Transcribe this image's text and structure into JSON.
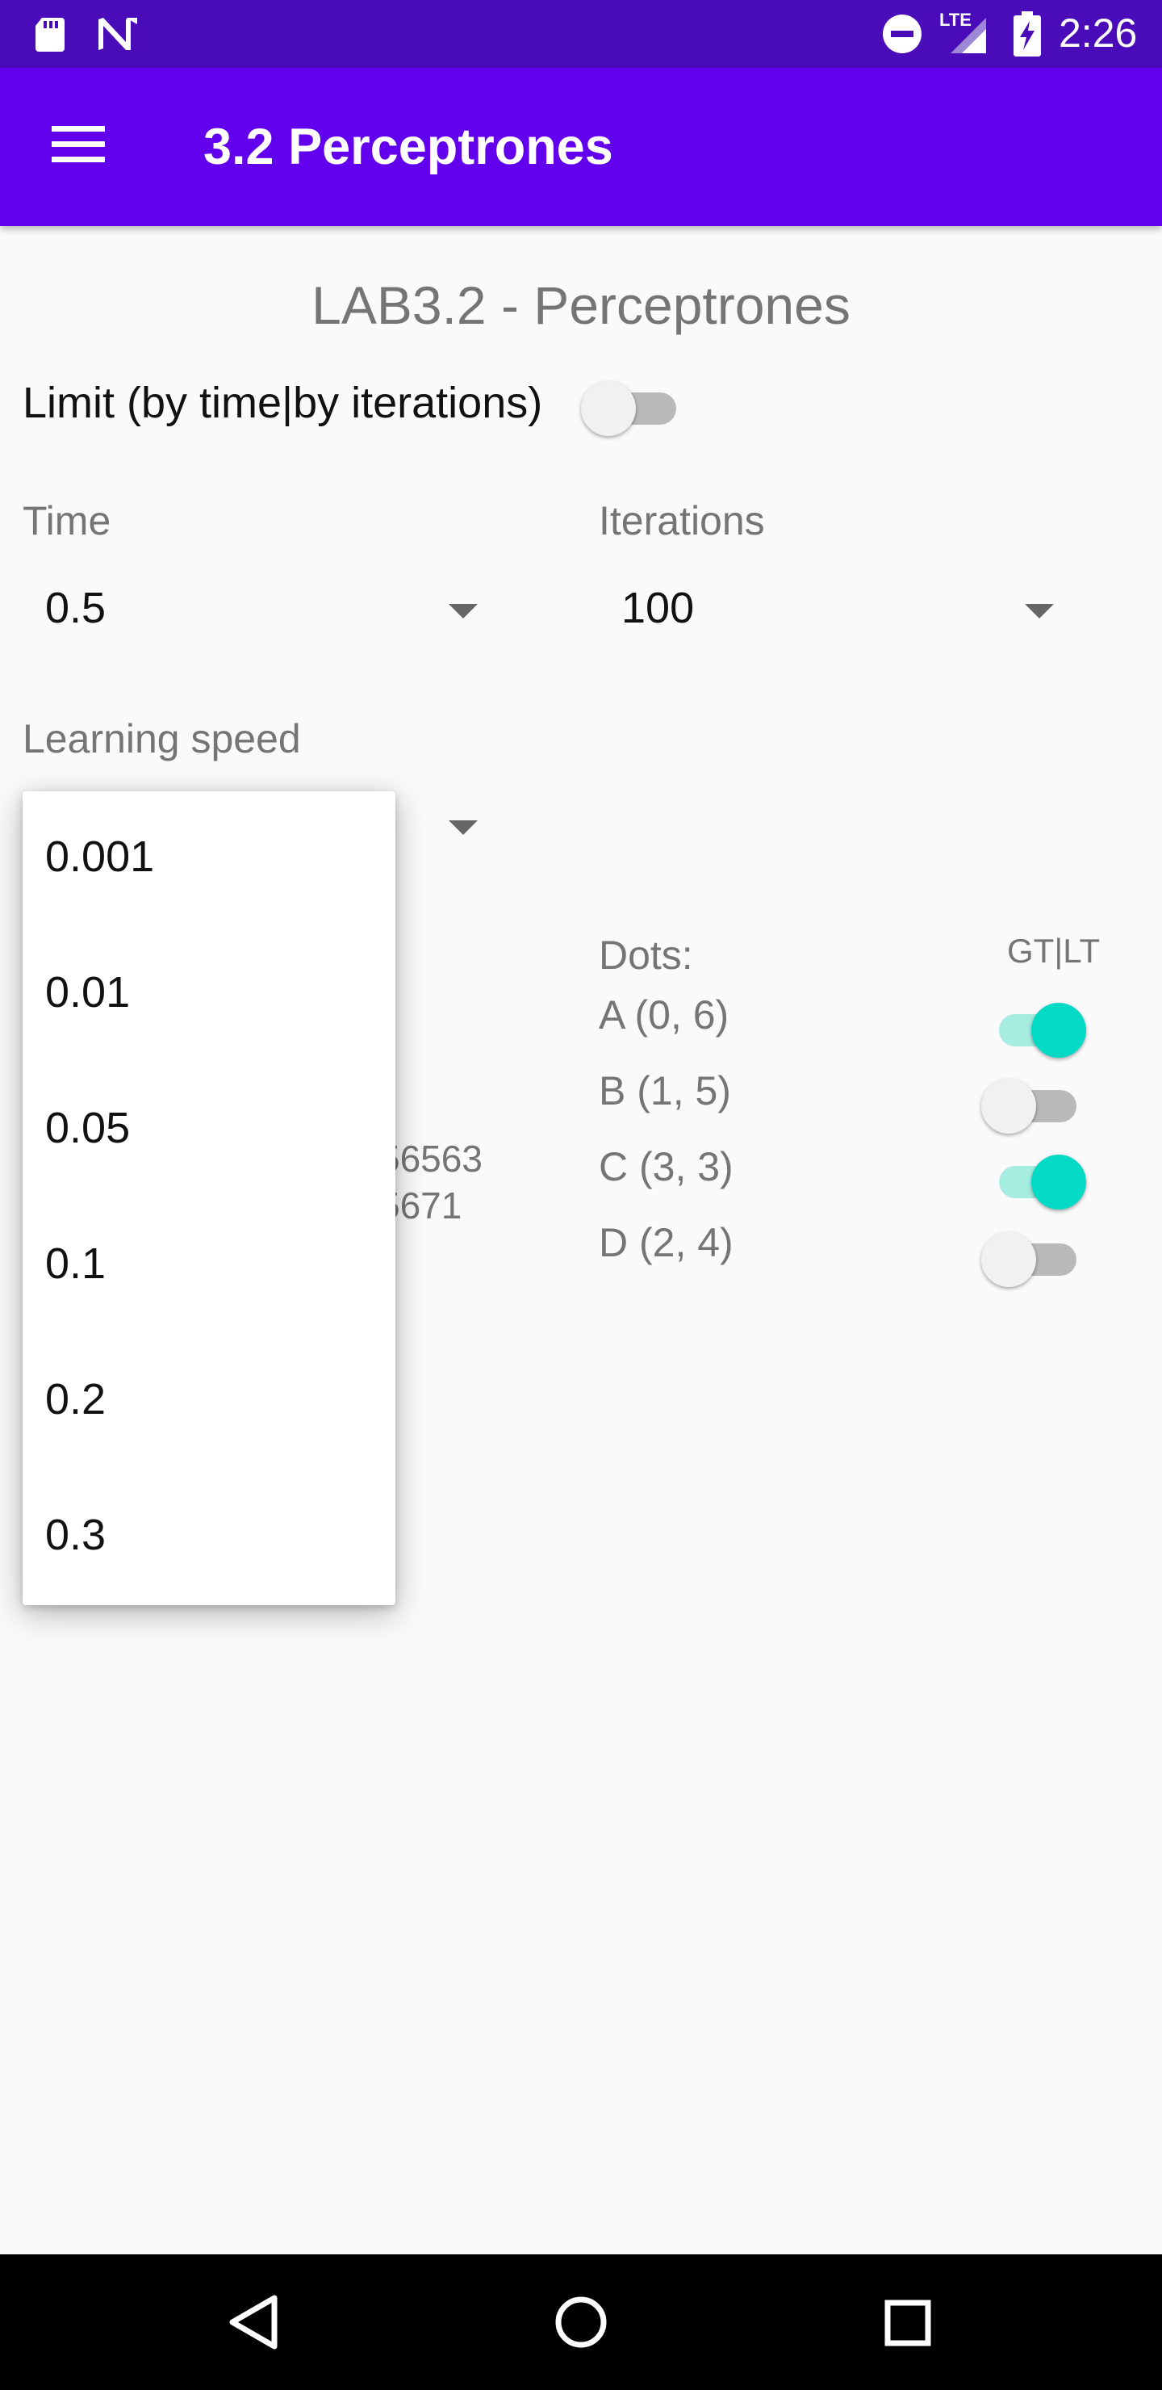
{
  "status_bar": {
    "time": "2:26",
    "network": "LTE",
    "left_icons": [
      "sd-card-icon",
      "notification-n-icon"
    ],
    "right_icons": [
      "do-not-disturb-icon",
      "signal-icon",
      "battery-charging-icon"
    ],
    "background": "#4a0bb8"
  },
  "app_bar": {
    "title": "3.2 Perceptrones",
    "menu_icon": "hamburger-menu-icon",
    "background": "#6200ee"
  },
  "content": {
    "page_title": "LAB3.2 - Perceptrones",
    "limit_toggle": {
      "label": "Limit (by time|by iterations)",
      "on": false
    },
    "time_field": {
      "label": "Time",
      "value": "0.5"
    },
    "iterations_field": {
      "label": "Iterations",
      "value": "100"
    },
    "learning_speed_field": {
      "label": "Learning speed"
    },
    "partial_results": [
      "56563",
      "5671"
    ],
    "dots": {
      "header": "Dots:",
      "toggle_header": "GT|LT",
      "items": [
        {
          "label": "A (0, 6)",
          "on": true
        },
        {
          "label": "B (1, 5)",
          "on": false
        },
        {
          "label": "C (3, 3)",
          "on": true
        },
        {
          "label": "D (2, 4)",
          "on": false
        }
      ]
    }
  },
  "dropdown_popup": {
    "options": [
      "0.001",
      "0.01",
      "0.05",
      "0.1",
      "0.2",
      "0.3"
    ]
  },
  "nav_bar": {
    "buttons": [
      "back-icon",
      "home-icon",
      "recents-icon"
    ]
  },
  "colors": {
    "accent": "#03dac5",
    "accent_track": "#a6ece1",
    "primary": "#6200ee"
  }
}
